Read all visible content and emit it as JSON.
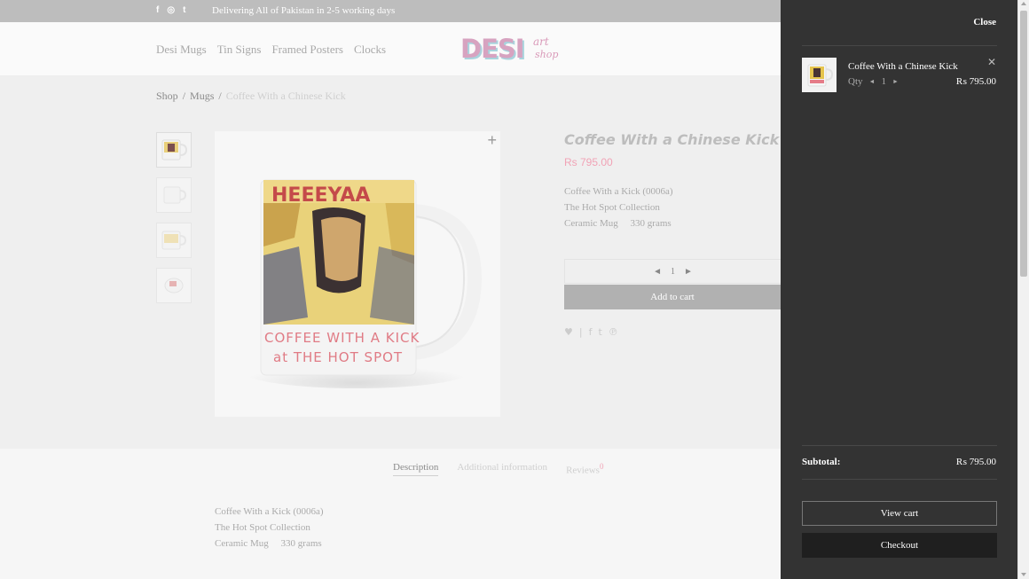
{
  "topbar": {
    "social": {
      "facebook": "f",
      "instagram": "◎",
      "twitter": "t"
    },
    "message": "Delivering All of Pakistan in 2-5 working days"
  },
  "nav": {
    "items": [
      "Desi Mugs",
      "Tin Signs",
      "Framed Posters",
      "Clocks"
    ]
  },
  "logo": {
    "main": "DESI",
    "sub1": "art",
    "sub2": "shop"
  },
  "breadcrumb": {
    "items": [
      "Shop",
      "Mugs",
      "Coffee With a Chinese Kick"
    ],
    "separator": "/"
  },
  "product": {
    "title": "Coffee With a Chinese Kick",
    "price": "Rs 795.00",
    "description": [
      "Coffee With a Kick (0006a)",
      "The Hot Spot Collection",
      "Ceramic Mug     330 grams"
    ],
    "quantity": "1",
    "add_to_cart": "Add to cart",
    "mug_text_top": "HEEEYAA",
    "mug_text_line1": "COFFEE WITH A KICK",
    "mug_text_line2": "at THE HOT SPOT",
    "zoom_icon": "+"
  },
  "tabs": {
    "description": "Description",
    "additional": "Additional information",
    "reviews": "Reviews",
    "reviews_count": "0"
  },
  "tab_content": [
    "Coffee With a Kick (0006a)",
    "The Hot Spot Collection",
    "Ceramic Mug     330 grams"
  ],
  "cart": {
    "close": "Close",
    "item": {
      "title": "Coffee With a Chinese Kick",
      "qty_label": "Qty",
      "qty": "1",
      "price": "₨ 795.00",
      "remove": "✕"
    },
    "subtotal_label": "Subtotal:",
    "subtotal_value": "₨ 795.00",
    "view_cart": "View cart",
    "checkout": "Checkout"
  },
  "colors": {
    "drawer_bg": "#333333",
    "accent_pink": "#f1a3b6",
    "checkout_bg": "#1f1f1f"
  }
}
